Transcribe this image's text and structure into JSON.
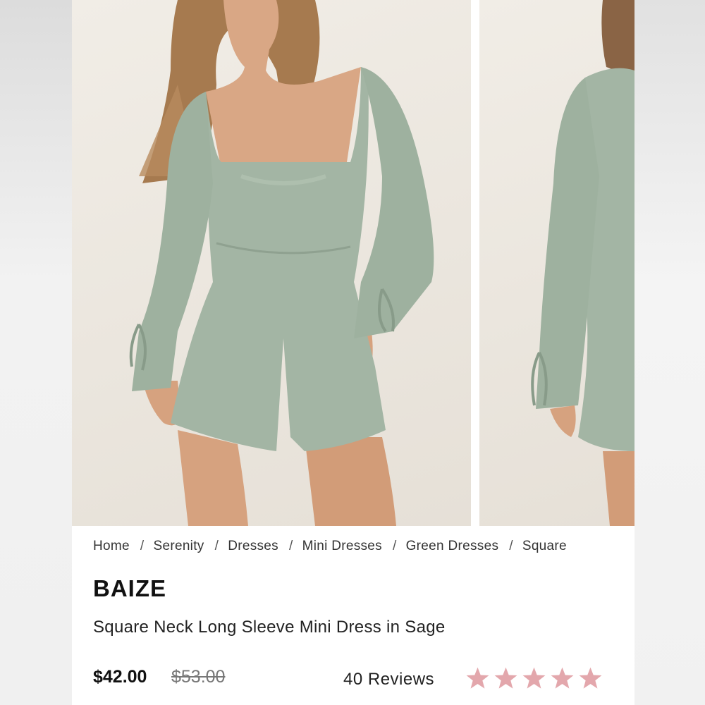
{
  "breadcrumb": {
    "items": [
      "Home",
      "Serenity",
      "Dresses",
      "Mini Dresses",
      "Green Dresses",
      "Square"
    ],
    "separator": "/"
  },
  "product": {
    "brand": "BAIZE",
    "title": "Square Neck Long Sleeve Mini Dress in Sage",
    "price": "$42.00",
    "original_price": "$53.00",
    "reviews_label": "40 Reviews",
    "rating": 5,
    "rating_max": 5
  },
  "gallery": {
    "images": [
      "main-photo",
      "second-photo"
    ]
  },
  "colors": {
    "dress": "#a3b5a4",
    "star": "#e3a7ac"
  }
}
